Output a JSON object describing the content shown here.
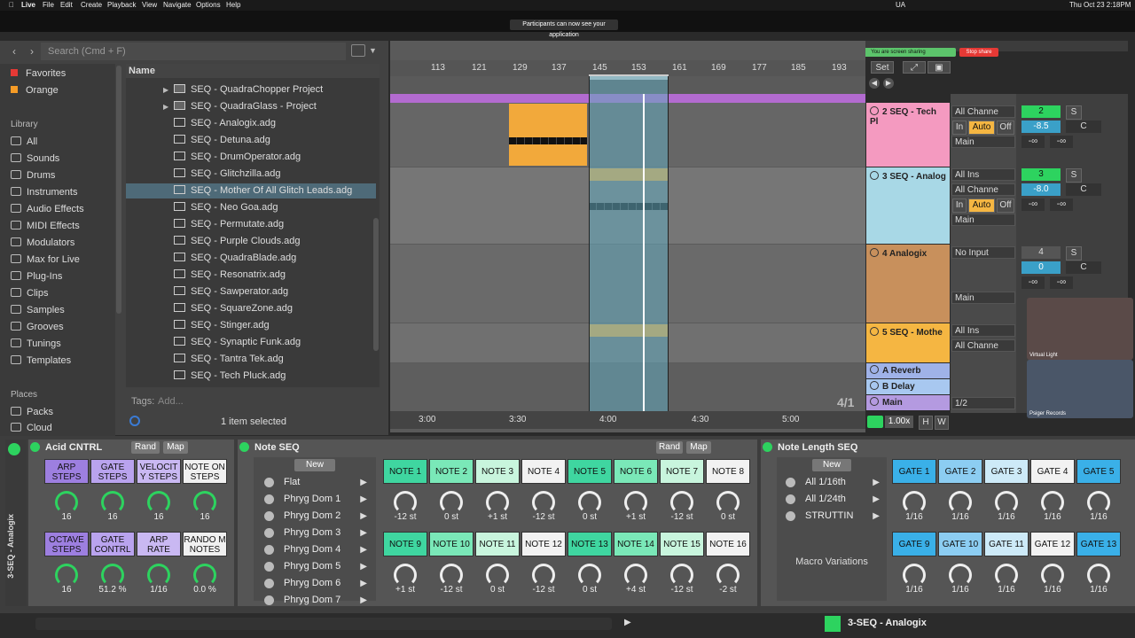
{
  "menubar": {
    "app": "Live",
    "menus": [
      "File",
      "Edit",
      "Create",
      "Playback",
      "View",
      "Navigate",
      "Options",
      "Help"
    ],
    "ua": "UA",
    "clock": "Thu Oct 23  2:18PM"
  },
  "notice": "Participants can now see your application",
  "screenshare": {
    "label": "You are screen sharing",
    "stop": "Stop share"
  },
  "browser": {
    "search_placeholder": "Search (Cmd + F)",
    "column_name": "Name",
    "collections_label_favorites": "Favorites",
    "collections_label_orange": "Orange",
    "library_header": "Library",
    "library_items": [
      "All",
      "Sounds",
      "Drums",
      "Instruments",
      "Audio Effects",
      "MIDI Effects",
      "Modulators",
      "Max for Live",
      "Plug-Ins",
      "Clips",
      "Samples",
      "Grooves",
      "Tunings",
      "Templates"
    ],
    "places_header": "Places",
    "places_items": [
      "Packs",
      "Cloud"
    ],
    "folders": [
      "SEQ - QuadraChopper Project",
      "SEQ - QuadraGlass - Project"
    ],
    "files": [
      "SEQ - Analogix.adg",
      "SEQ - Detuna.adg",
      "SEQ - DrumOperator.adg",
      "SEQ - Glitchzilla.adg",
      "SEQ - Mother Of All Glitch Leads.adg",
      "SEQ - Neo Goa.adg",
      "SEQ - Permutate.adg",
      "SEQ - Purple Clouds.adg",
      "SEQ - QuadraBlade.adg",
      "SEQ - Resonatrix.adg",
      "SEQ - Sawperator.adg",
      "SEQ - SquareZone.adg",
      "SEQ - Stinger.adg",
      "SEQ - Synaptic Funk.adg",
      "SEQ - Tantra Tek.adg",
      "SEQ - Tech Pluck.adg"
    ],
    "selected_file": "SEQ - Mother Of All Glitch Leads.adg",
    "tags_label": "Tags:",
    "tags_placeholder": "Add...",
    "status": "1 item selected"
  },
  "arrangement": {
    "bar_numbers": [
      "113",
      "121",
      "129",
      "137",
      "145",
      "153",
      "161",
      "169",
      "177",
      "185",
      "193"
    ],
    "set_label": "Set",
    "time_markers": [
      "3:00",
      "3:30",
      "4:00",
      "4:30",
      "5:00"
    ],
    "loop_display": "4/1",
    "zoom": "1.00x",
    "btn_h": "H",
    "btn_w": "W"
  },
  "tracks": [
    {
      "name": "2 SEQ - Tech Pl",
      "color": "#f49ac0",
      "input": "All Channe",
      "arm1": "In",
      "arm2": "Auto",
      "arm3": "Off",
      "output": "Main",
      "num": "2",
      "solo": "S",
      "vol": "-8.5",
      "pan": "C",
      "send1": "-∞",
      "send2": "-∞"
    },
    {
      "name": "3 SEQ - Analog",
      "color": "#a8d8e6",
      "input_type": "All Ins",
      "input": "All Channe",
      "arm1": "In",
      "arm2": "Auto",
      "arm3": "Off",
      "output": "Main",
      "num": "3",
      "solo": "S",
      "vol": "-8.0",
      "pan": "C",
      "send1": "-∞",
      "send2": "-∞"
    },
    {
      "name": "4 Analogix",
      "color": "#c8905c",
      "input_type": "No Input",
      "output": "Main",
      "num": "4",
      "solo": "S",
      "vol": "0",
      "pan": "C",
      "send1": "-∞",
      "send2": "-∞"
    },
    {
      "name": "5 SEQ - Mothe",
      "color": "#f5b642",
      "input_type": "All Ins",
      "input": "All Channe"
    }
  ],
  "returns": [
    {
      "name": "A Reverb",
      "color": "#9fb2e8"
    },
    {
      "name": "B Delay",
      "color": "#a8c8f0"
    },
    {
      "name": "Main",
      "color": "#b49ae0",
      "value": "1/2"
    }
  ],
  "webcams": [
    {
      "label": "Virtual Light"
    },
    {
      "label": "Psiger Records"
    }
  ],
  "devices": {
    "acid": {
      "title": "Acid CNTRL",
      "rand": "Rand",
      "map": "Map",
      "buttons": [
        "ARP STEPS",
        "GATE STEPS",
        "VELOCIT Y STEPS",
        "NOTE ON STEPS",
        "OCTAVE STEPS",
        "GATE CONTRL",
        "ARP RATE",
        "RANDO M NOTES"
      ],
      "values": [
        "16",
        "16",
        "16",
        "16",
        "16",
        "51.2 %",
        "1/16",
        "0.0 %"
      ]
    },
    "noteseq": {
      "title": "Note SEQ",
      "rand": "Rand",
      "map": "Map",
      "new": "New",
      "variations": [
        "Flat",
        "Phryg Dom 1",
        "Phryg Dom 2",
        "Phryg Dom 3",
        "Phryg Dom 4",
        "Phryg Dom 5",
        "Phryg Dom 6",
        "Phryg Dom 7"
      ],
      "notes": [
        "NOTE 1",
        "NOTE 2",
        "NOTE 3",
        "NOTE 4",
        "NOTE 5",
        "NOTE 6",
        "NOTE 7",
        "NOTE 8",
        "NOTE 9",
        "NOTE 10",
        "NOTE 11",
        "NOTE 12",
        "NOTE 13",
        "NOTE 14",
        "NOTE 15",
        "NOTE 16"
      ],
      "note_values": [
        "-12 st",
        "0 st",
        "+1 st",
        "-12 st",
        "0 st",
        "+1 st",
        "-12 st",
        "0 st",
        "+1 st",
        "-12 st",
        "0 st",
        "-12 st",
        "0 st",
        "+4 st",
        "-12 st",
        "-2 st"
      ]
    },
    "notelen": {
      "title": "Note Length SEQ",
      "new": "New",
      "variations": [
        "All 1/16th",
        "All 1/24th",
        "STRUTTIN"
      ],
      "macro_label": "Macro Variations",
      "gates": [
        "GATE 1",
        "GATE 2",
        "GATE 3",
        "GATE 4",
        "GATE 5",
        "GATE 9",
        "GATE 10",
        "GATE 11",
        "GATE 12",
        "GATE 13"
      ],
      "gate_values": [
        "1/16",
        "1/16",
        "1/16",
        "1/16",
        "1/16",
        "1/16",
        "1/16",
        "1/16",
        "1/16",
        "1/16"
      ]
    },
    "side_label": "3-SEQ - Analogix"
  },
  "bottom": {
    "track_label": "3-SEQ - Analogix"
  }
}
